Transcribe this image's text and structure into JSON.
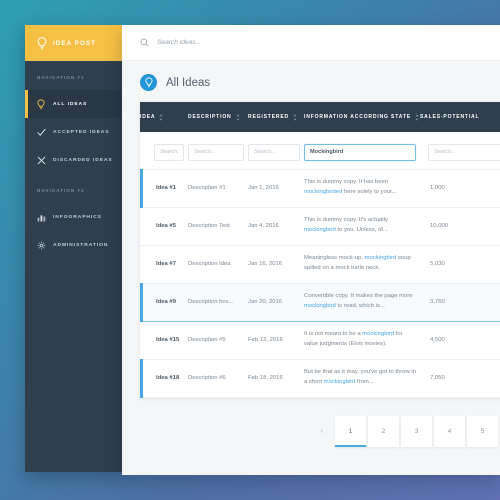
{
  "brand": {
    "name": "IDEA POST",
    "icon": "lightbulb-icon",
    "bg_color": "#f5c043"
  },
  "sidebar": {
    "sections": [
      {
        "title": "NAVIGATION #1",
        "items": [
          {
            "label": "ALL IDEAS",
            "icon": "lightbulb-icon",
            "active": true
          },
          {
            "label": "ACCEPTED IDEAS",
            "icon": "check-icon",
            "active": false
          },
          {
            "label": "DISCARDED IDEAS",
            "icon": "close-x-icon",
            "active": false
          }
        ]
      },
      {
        "title": "NAVIGATION #2",
        "items": [
          {
            "label": "INFOGRAPHICS",
            "icon": "bar-chart-icon",
            "active": false
          },
          {
            "label": "ADMINISTRATION",
            "icon": "gear-icon",
            "active": false
          }
        ]
      }
    ]
  },
  "topbar": {
    "search_icon": "search-icon",
    "search_placeholder": "Search ideas...",
    "search_value": ""
  },
  "page": {
    "title": "All Ideas",
    "title_icon": "lightbulb-icon",
    "title_badge_color": "#2196d8"
  },
  "table": {
    "columns": [
      {
        "label": "IDEA",
        "sortable": true
      },
      {
        "label": "DESCRIPTION",
        "sortable": true
      },
      {
        "label": "REGISTERED",
        "sortable": true
      },
      {
        "label": "INFORMATION ACCORDING STATE",
        "sortable": true
      },
      {
        "label": "SALES-POTENTIAL",
        "sortable": true
      }
    ],
    "filters": [
      {
        "placeholder": "Search...",
        "value": "",
        "focused": false
      },
      {
        "placeholder": "Search...",
        "value": "",
        "focused": false
      },
      {
        "placeholder": "Search...",
        "value": "",
        "focused": false
      },
      {
        "placeholder": "Search...",
        "value": "Mockingbird",
        "focused": true
      },
      {
        "placeholder": "Search...",
        "value": "",
        "focused": false
      }
    ],
    "rows": [
      {
        "idea": "Idea #1",
        "description": "Description #1",
        "registered": "Jan 1, 2016",
        "info_pre": "This is dummy copy. It has been ",
        "info_link": "mockingbirded",
        "info_post": " here solely to your...",
        "sales": "1,000",
        "accent": true,
        "selected": false
      },
      {
        "idea": "Idea #5",
        "description": "Description Text",
        "registered": "Jan 4, 2016",
        "info_pre": "This is dummy copy. It's actually ",
        "info_link": "mockingbird",
        "info_post": " to you. Unless, of...",
        "sales": "10,000",
        "accent": false,
        "selected": false
      },
      {
        "idea": "Idea #7",
        "description": "Description Idea",
        "registered": "Jan 16, 2016",
        "info_pre": "Meaningless mock-up, ",
        "info_link": "mockingbird",
        "info_post": " soup spilled on a mock turtle neck.",
        "sales": "5,030",
        "accent": false,
        "selected": false
      },
      {
        "idea": "Idea #9",
        "description": "Description hov...",
        "registered": "Jan 20, 2016",
        "info_pre": "Convertible copy. It makes the page more ",
        "info_link": "mockingbird",
        "info_post": " to read, which is...",
        "sales": "3,750",
        "accent": true,
        "selected": true
      },
      {
        "idea": "Idea #15",
        "description": "Description #5",
        "registered": "Feb 12, 2016",
        "info_pre": "It is not meant to be a ",
        "info_link": "mockingbird",
        "info_post": " for value judgments (Elvis movies).",
        "sales": "4,500",
        "accent": false,
        "selected": false
      },
      {
        "idea": "Idea #18",
        "description": "Description #6",
        "registered": "Feb 18, 2016",
        "info_pre": "But be that as it may, you've got to throw in a short ",
        "info_link": "mockingbird",
        "info_post": " from...",
        "sales": "7,050",
        "accent": true,
        "selected": false
      }
    ]
  },
  "pagination": {
    "prev_label": "‹",
    "pages": [
      "1",
      "2",
      "3",
      "4",
      "5"
    ],
    "active_page": "1",
    "active_underline_color": "#4aa8e0"
  }
}
